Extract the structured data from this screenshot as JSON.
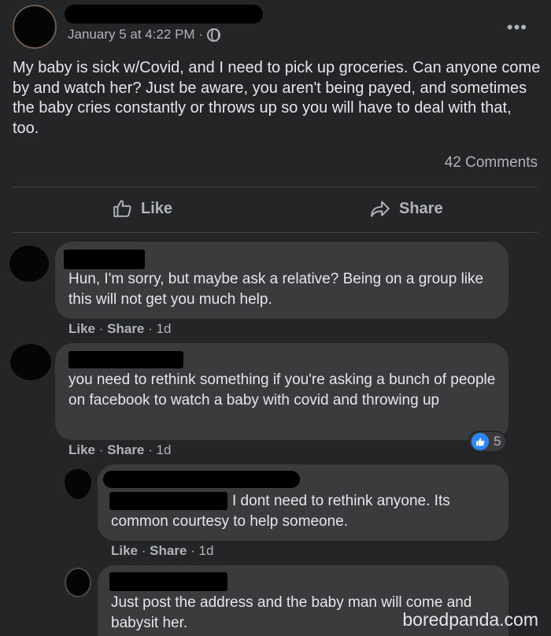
{
  "post": {
    "date": "January 5 at 4:22 PM ·",
    "more_label": "•••",
    "text": "My baby is sick w/Covid, and I need to pick up groceries. Can anyone come by and watch her? Just be aware, you aren't being payed, and sometimes the baby cries constantly or throws up so you will have to deal with that, too.",
    "comments_count": "42 Comments",
    "like_label": "Like",
    "share_label": "Share"
  },
  "comments": [
    {
      "text": "Hun, I'm sorry, but maybe ask a relative? Being on a group like this will not get you much help.",
      "like": "Like",
      "share": "Share",
      "sep": " · ",
      "time": " · 1d"
    },
    {
      "text": "you need to rethink something if you're asking a bunch of people on facebook to watch a baby with covid and throwing up",
      "like": "Like",
      "share": "Share",
      "sep": " · ",
      "time": " · 1d",
      "reaction_count": "5"
    },
    {
      "text": "I dont need to rethink anyone. Its common courtesy to help someone.",
      "like": "Like",
      "share": "Share",
      "sep": " · ",
      "time": " · 1d"
    },
    {
      "text": "Just post the address and the baby man will come and babysit her."
    }
  ],
  "watermark": "boredpanda.com",
  "colors": {
    "background": "#232526",
    "bubble": "#3a3b3c",
    "text": "#e4e6eb",
    "secondary": "#b0b3b8",
    "like_blue": "#2d88ff"
  }
}
